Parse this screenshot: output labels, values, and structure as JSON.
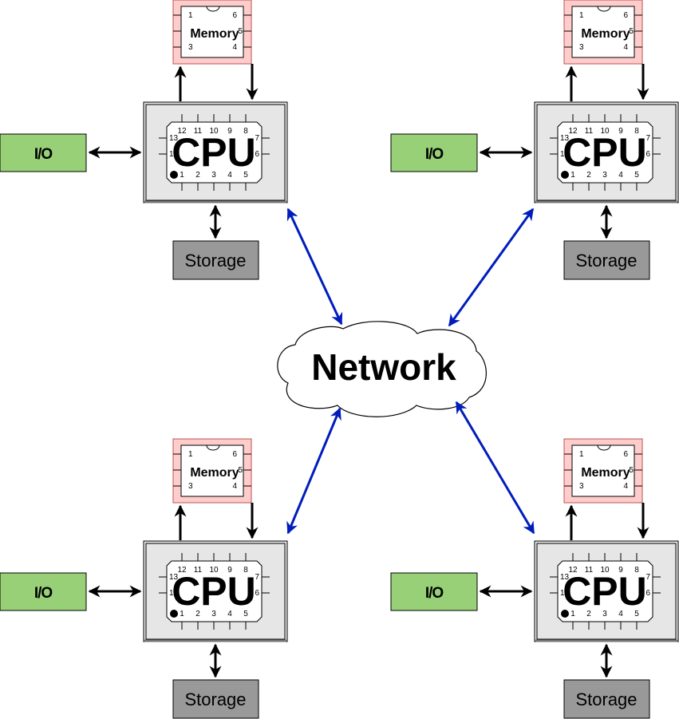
{
  "diagram": {
    "network": {
      "label": "Network"
    },
    "colors": {
      "io_fill": "#97d077",
      "storage_fill": "#999999",
      "memory_fill": "#ffcccc",
      "cpu_fill": "#e6e6e6",
      "network_link": "#001dbc",
      "local_link": "#000000"
    },
    "chip_pins": {
      "cpu_top": [
        "12",
        "11",
        "10",
        "9",
        "8"
      ],
      "cpu_bottom": [
        "1",
        "2",
        "3",
        "4",
        "5"
      ],
      "cpu_left": [
        "13",
        "14"
      ],
      "cpu_right": [
        "7",
        "6"
      ],
      "memory_left": [
        "1",
        "3"
      ],
      "memory_right": [
        "6",
        "5",
        "4"
      ]
    },
    "nodes": [
      {
        "id": "top-left",
        "cpu_label": "CPU",
        "memory_label": "Memory",
        "io_label": "I/O",
        "storage_label": "Storage"
      },
      {
        "id": "top-right",
        "cpu_label": "CPU",
        "memory_label": "Memory",
        "io_label": "I/O",
        "storage_label": "Storage"
      },
      {
        "id": "bottom-left",
        "cpu_label": "CPU",
        "memory_label": "Memory",
        "io_label": "I/O",
        "storage_label": "Storage"
      },
      {
        "id": "bottom-right",
        "cpu_label": "CPU",
        "memory_label": "Memory",
        "io_label": "I/O",
        "storage_label": "Storage"
      }
    ],
    "connections": [
      {
        "from": "top-left.cpu",
        "to": "network",
        "type": "bidirectional"
      },
      {
        "from": "top-right.cpu",
        "to": "network",
        "type": "bidirectional"
      },
      {
        "from": "bottom-left.cpu",
        "to": "network",
        "type": "bidirectional"
      },
      {
        "from": "bottom-right.cpu",
        "to": "network",
        "type": "bidirectional"
      },
      {
        "from": "cpu",
        "to": "memory",
        "type": "directed",
        "scope": "each-node"
      },
      {
        "from": "memory",
        "to": "cpu",
        "type": "directed",
        "scope": "each-node"
      },
      {
        "from": "io",
        "to": "cpu",
        "type": "bidirectional",
        "scope": "each-node"
      },
      {
        "from": "cpu",
        "to": "storage",
        "type": "bidirectional",
        "scope": "each-node"
      }
    ]
  }
}
